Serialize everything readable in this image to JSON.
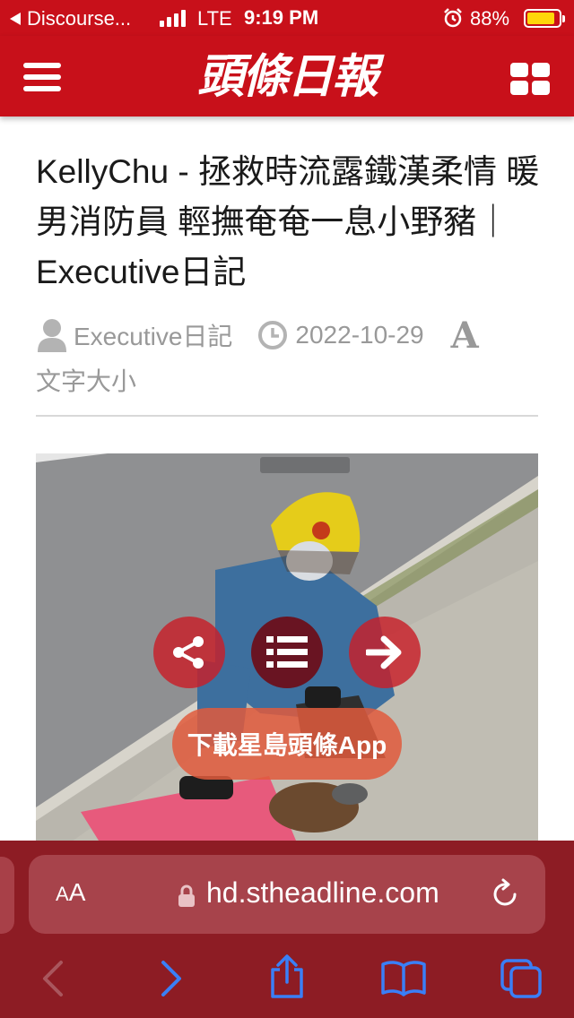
{
  "status_bar": {
    "back_app": "Discourse...",
    "network": "LTE",
    "time": "9:19 PM",
    "battery": "88%",
    "battery_level": 0.88
  },
  "header": {
    "logo": "頭條日報"
  },
  "article": {
    "title": "KellyChu - 拯救時流露鐵漢柔情 暖男消防員 輕撫奄奄一息小野豬｜Executive日記",
    "author": "Executive日記",
    "date": "2022-10-29",
    "font_size_icon": "A",
    "font_size_label": "文字大小"
  },
  "overlay": {
    "download_label": "下載星島頭條App"
  },
  "safari": {
    "aa_label_small": "A",
    "aa_label_large": "A",
    "url": "hd.stheadline.com"
  },
  "colors": {
    "brand_red": "#c8101a",
    "safari_bar": "#8d1c24",
    "meta_gray": "#999999",
    "toolbar_blue": "#3a7ff6"
  }
}
